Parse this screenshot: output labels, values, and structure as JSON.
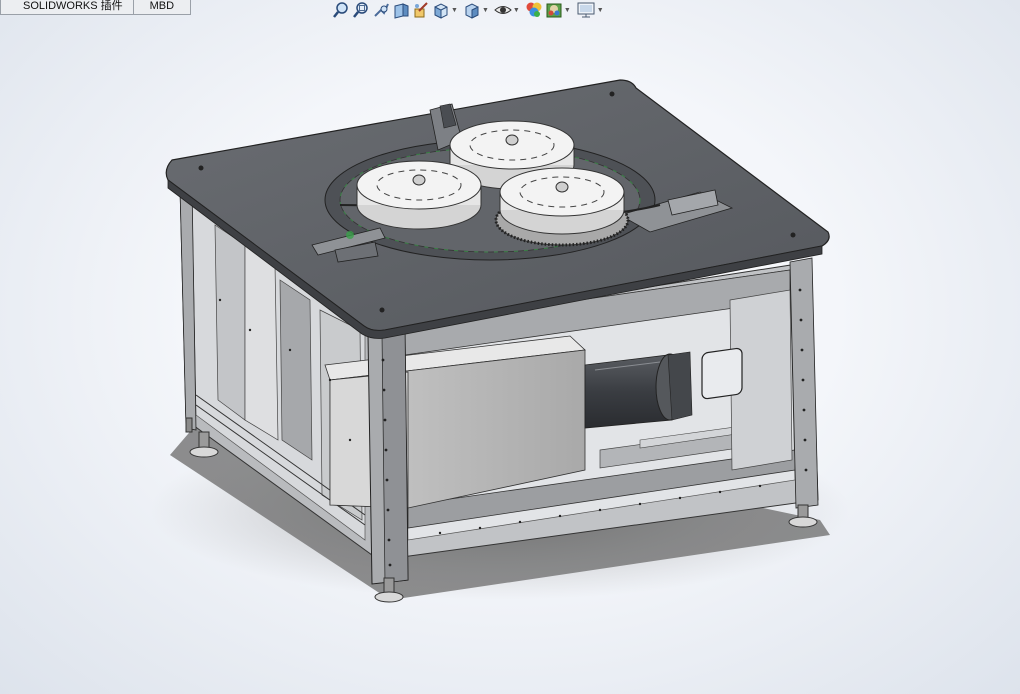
{
  "tabs": [
    {
      "label": "SOLIDWORKS 插件"
    },
    {
      "label": "MBD"
    }
  ],
  "view_toolbar": [
    {
      "icon": "zoom-to-fit-icon"
    },
    {
      "icon": "zoom-to-area-icon"
    },
    {
      "icon": "previous-view-icon"
    },
    {
      "icon": "section-view-icon"
    },
    {
      "icon": "dynamic-annotation-icon"
    },
    {
      "icon": "view-orientation-icon",
      "dropdown": true
    },
    {
      "icon": "display-style-icon",
      "dropdown": true
    },
    {
      "icon": "hide-show-items-icon",
      "dropdown": true
    },
    {
      "icon": "edit-appearance-icon"
    },
    {
      "icon": "apply-scene-icon",
      "dropdown": true
    },
    {
      "icon": "view-settings-icon",
      "dropdown": true
    }
  ],
  "colors": {
    "table_top": "#5e6166",
    "frame": "#8a8d92",
    "gear": "#efefef",
    "motor_housing": "#c4c4c4",
    "motor": "#3e4145"
  }
}
